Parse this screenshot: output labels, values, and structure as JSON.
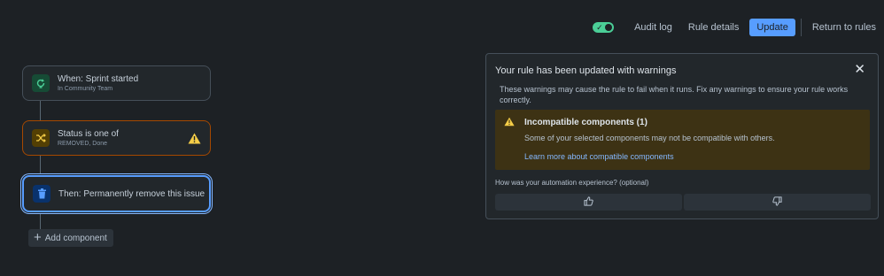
{
  "toolbar": {
    "toggle_state": "on",
    "audit_log": "Audit log",
    "rule_details": "Rule details",
    "update": "Update",
    "return_to_rules": "Return to rules"
  },
  "flow": {
    "trigger": {
      "title": "When: Sprint started",
      "subtitle": "In Community Team",
      "icon": "sprint-icon"
    },
    "condition": {
      "title": "Status is one of",
      "subtitle": "REMOVED, Done",
      "icon": "shuffle-icon",
      "warning_icon": "warning-icon"
    },
    "action": {
      "title": "Then: Permanently remove this issue",
      "icon": "trash-icon"
    },
    "add_component": "Add component"
  },
  "panel": {
    "title": "Your rule has been updated with warnings",
    "description": "These warnings may cause the rule to fail when it runs. Fix any warnings to ensure your rule works correctly.",
    "warning": {
      "title": "Incompatible components (1)",
      "body": "Some of your selected components may not be compatible with others.",
      "link": "Learn more about compatible components"
    },
    "feedback_question": "How was your automation experience? (optional)",
    "thumbs_up_icon": "thumbs-up-icon",
    "thumbs_down_icon": "thumbs-down-icon"
  },
  "colors": {
    "background": "#1d2125",
    "accent": "#579dff",
    "warning": "#f5cd47",
    "success": "#4bce97"
  }
}
